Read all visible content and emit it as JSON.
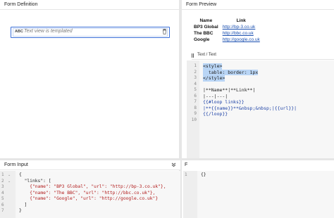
{
  "panels": {
    "form_definition": {
      "title": "Form Definition"
    },
    "form_preview": {
      "title": "Form Preview"
    },
    "form_input": {
      "title": "Form Input"
    },
    "output": {
      "title_fragment": "F"
    }
  },
  "component": {
    "type_badge": "ABC",
    "placeholder_text": "Text view is templated",
    "delete_icon": "trash-icon"
  },
  "preview_table": {
    "headers": [
      "Name",
      "Link"
    ],
    "rows": [
      {
        "name": "BP3 Global",
        "url": "http://bp-3.co.uk"
      },
      {
        "name": "The BBC",
        "url": "http://bbc.co.uk"
      },
      {
        "name": "Google",
        "url": "http://google.co.uk"
      }
    ]
  },
  "editor": {
    "title": "Text / Text",
    "lines": [
      {
        "n": "1",
        "text": "<style>"
      },
      {
        "n": "2",
        "text": "  table: border: 1px"
      },
      {
        "n": "3",
        "text": "</style>"
      },
      {
        "n": "4",
        "text": ""
      },
      {
        "n": "5",
        "text": "|**Name**|**Link**|"
      },
      {
        "n": "6",
        "text": "|---|---|"
      },
      {
        "n": "7",
        "text": "{{#loop links}}"
      },
      {
        "n": "8",
        "text": "|**{{name}}**&nbsp;&nbsp;|{{url}}|"
      },
      {
        "n": "9",
        "text": "{{/loop}}"
      },
      {
        "n": "10",
        "text": ""
      }
    ]
  },
  "form_input": {
    "lines": [
      {
        "n": "1",
        "fold": "⌄",
        "text": "{"
      },
      {
        "n": "2",
        "fold": "⌄",
        "text": "  \"links\": ["
      },
      {
        "n": "3",
        "fold": "",
        "text": "    {\"name\": \"BP3 Global\", \"url\": \"http://bp-3.co.uk\"},"
      },
      {
        "n": "4",
        "fold": "",
        "text": "    {\"name\": \"The BBC\", \"url\": \"http://bbc.co.uk\"},"
      },
      {
        "n": "5",
        "fold": "",
        "text": "    {\"name\": \"Google\", \"url\": \"http://google.co.uk\"}"
      },
      {
        "n": "6",
        "fold": "",
        "text": "  ]"
      },
      {
        "n": "7",
        "fold": "",
        "text": "}"
      }
    ]
  },
  "output": {
    "lines": [
      {
        "n": "1",
        "text": "{}"
      }
    ]
  },
  "colors": {
    "selection": "#3a6fd8",
    "link": "#1a4fb0",
    "highlight": "#b9d5f5"
  }
}
